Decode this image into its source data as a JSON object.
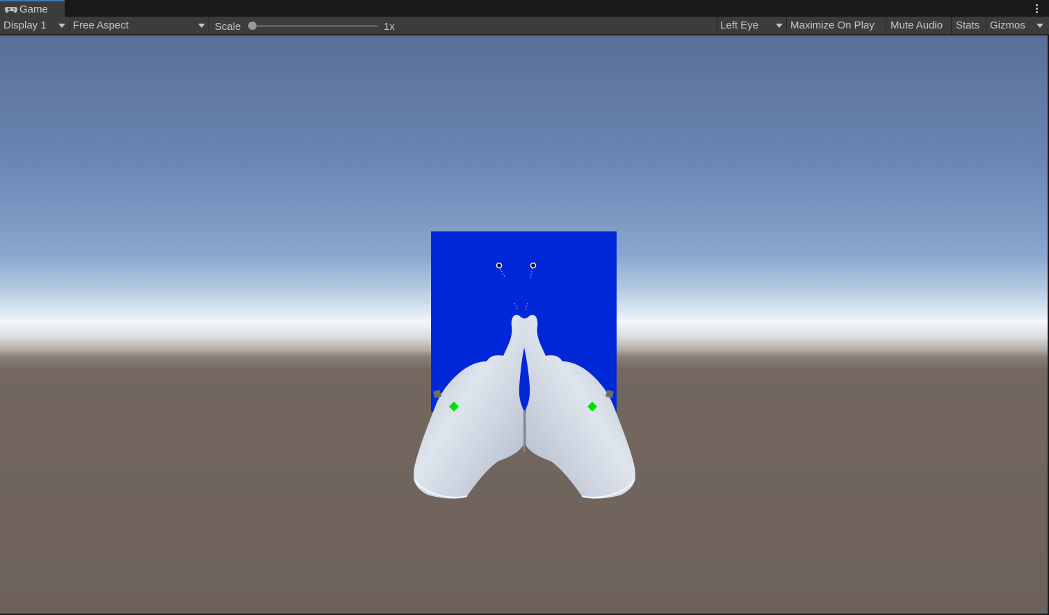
{
  "window": {
    "tab_title": "Game",
    "tab_icon": "gamepad-icon",
    "menu_icon": "kebab-menu-icon"
  },
  "toolbar": {
    "display": "Display 1",
    "aspect": "Free Aspect",
    "scale_label": "Scale",
    "scale_value": "1x",
    "scale_slider_fraction": 0,
    "eye": "Left Eye",
    "maximize_on_play": "Maximize On Play",
    "mute_audio": "Mute Audio",
    "stats": "Stats",
    "gizmos": "Gizmos"
  },
  "scene": {
    "sky_color_top": "#5a6f98",
    "horizon_color": "#f4f7fb",
    "ground_color": "#6d615b",
    "panel_color": "#0028d8",
    "hand_color": "#c9d1dc",
    "marker_color": "#00e000",
    "objects": [
      "blue-panel",
      "left-hand",
      "right-hand",
      "left-anchor-marker",
      "right-anchor-marker",
      "left-tracking-point",
      "right-tracking-point"
    ]
  }
}
